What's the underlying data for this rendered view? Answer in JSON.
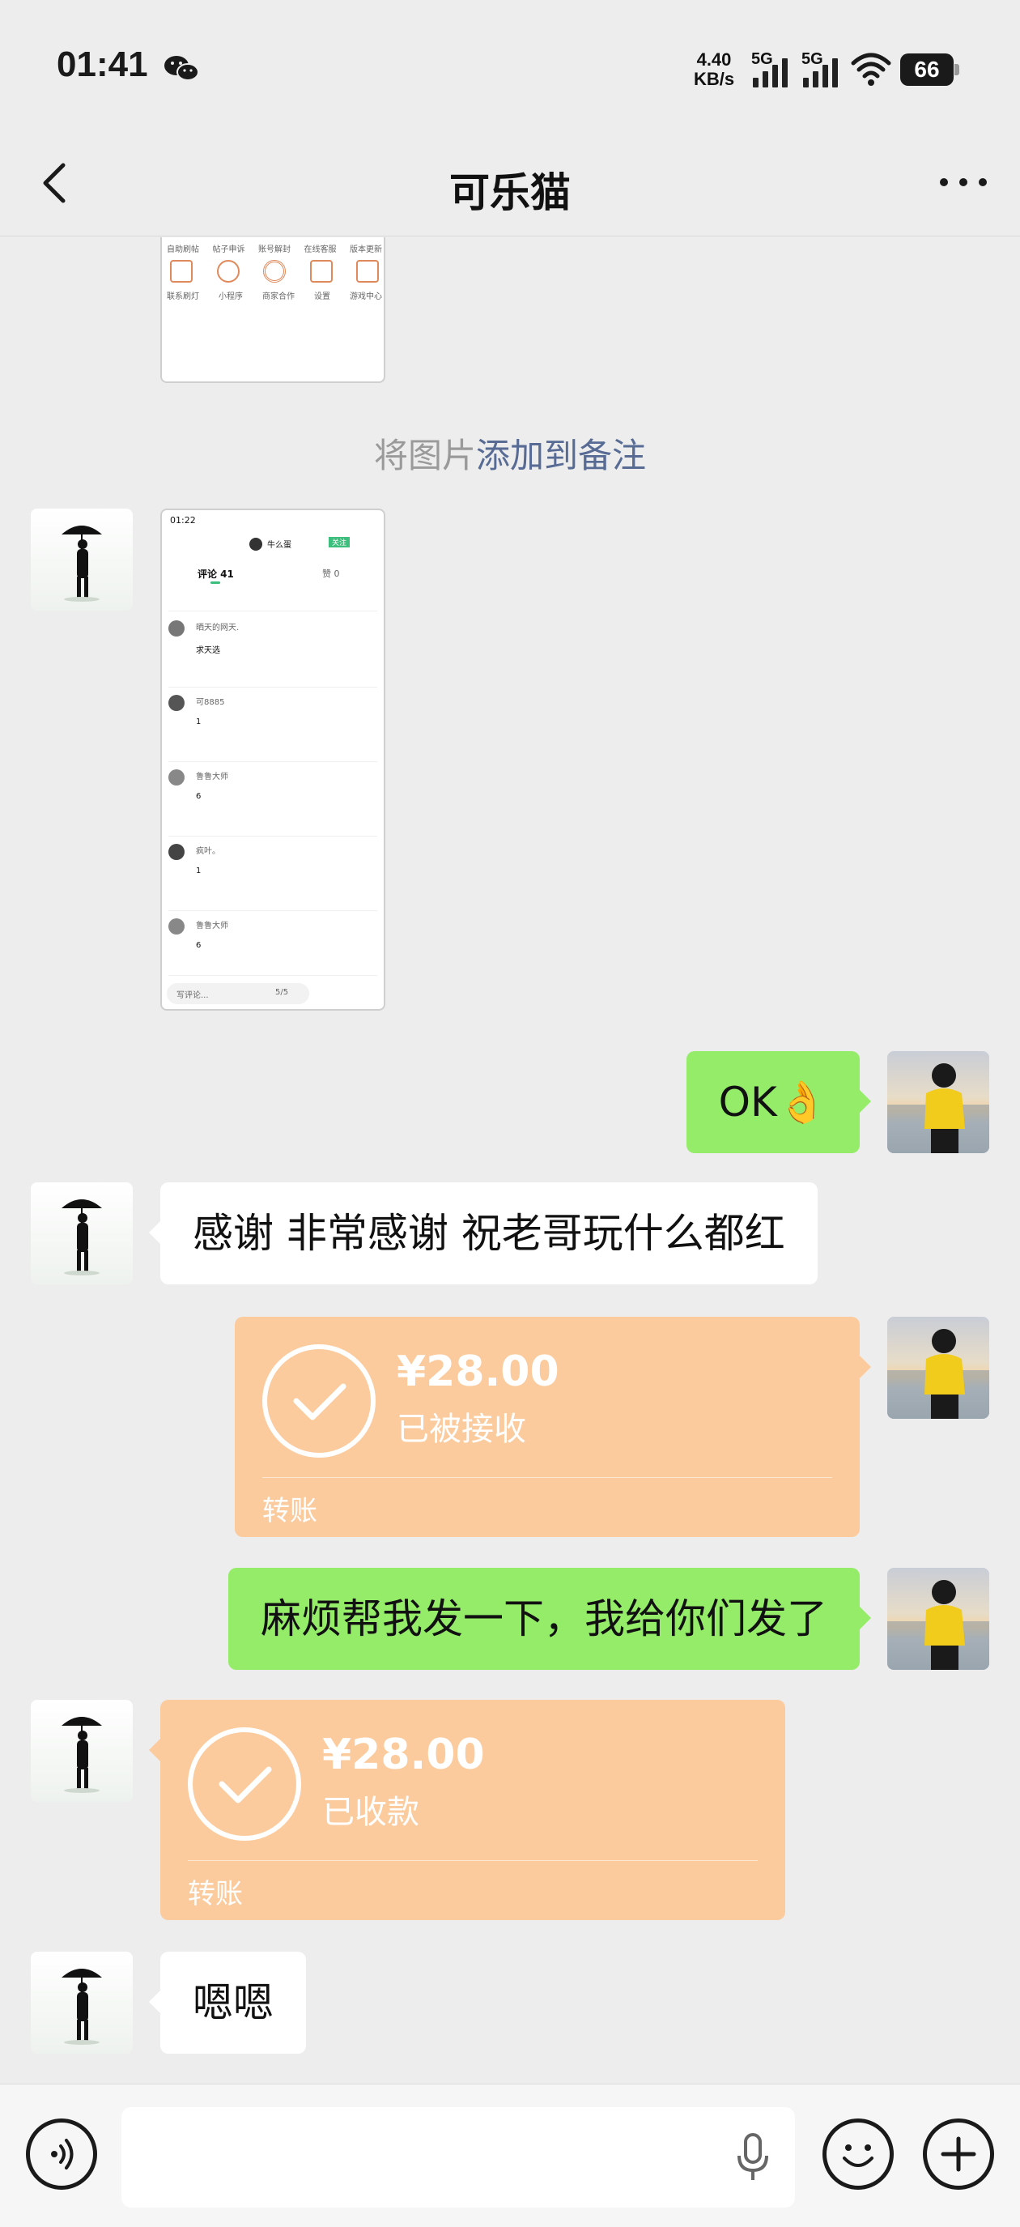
{
  "status_bar": {
    "time": "01:41",
    "speed_value": "4.40",
    "speed_unit": "KB/s",
    "network_1": "5G",
    "network_2": "5G",
    "battery": "66",
    "icons": [
      "wechat-icon",
      "signal-icon",
      "wifi-icon",
      "battery-icon"
    ]
  },
  "header": {
    "title": "可乐猫",
    "back_icon": "chevron-left-icon",
    "more_icon": "more-dots-icon"
  },
  "chat": {
    "hint_prefix": "将图片",
    "hint_link": "添加到备注",
    "thumb_top": {
      "labels_row1": [
        "自助刷帖",
        "帖子申诉",
        "账号解封",
        "在线客服",
        "版本更新"
      ],
      "labels_row2": [
        "联系刷灯",
        "小程序",
        "商家合作",
        "设置",
        "游戏中心"
      ]
    },
    "thumb_comments": {
      "time": "01:22",
      "user": "牛么蛋",
      "follow": "关注",
      "tab_comments": "评论 41",
      "tab_likes": "赞 0",
      "entries": [
        {
          "name": "晒天的网天.",
          "text": "求天选"
        },
        {
          "name": "可8885",
          "text": "1"
        },
        {
          "name": "鲁鲁大师",
          "text": "6"
        },
        {
          "name": "疯叶。",
          "text": "1"
        },
        {
          "name": "鲁鲁大师",
          "text": "6"
        }
      ],
      "input_placeholder": "写评论...",
      "page": "5/5"
    },
    "msg_ok": "OK👌",
    "msg_thanks": "感谢 非常感谢  祝老哥玩什么都红",
    "transfer_sent": {
      "amount": "¥28.00",
      "status": "已被接收",
      "label": "转账"
    },
    "msg_request": "麻烦帮我发一下，我给你们发了",
    "transfer_received": {
      "amount": "¥28.00",
      "status": "已收款",
      "label": "转账"
    },
    "msg_ok2": "嗯嗯"
  },
  "input_bar": {
    "voice_icon": "voice-icon",
    "mic_icon": "microphone-icon",
    "emoji_icon": "emoji-icon",
    "plus_icon": "plus-icon"
  },
  "colors": {
    "background": "#ededed",
    "bubble_sent": "#95ec69",
    "bubble_received": "#ffffff",
    "transfer": "#fbcb9d",
    "link": "#576b95"
  }
}
